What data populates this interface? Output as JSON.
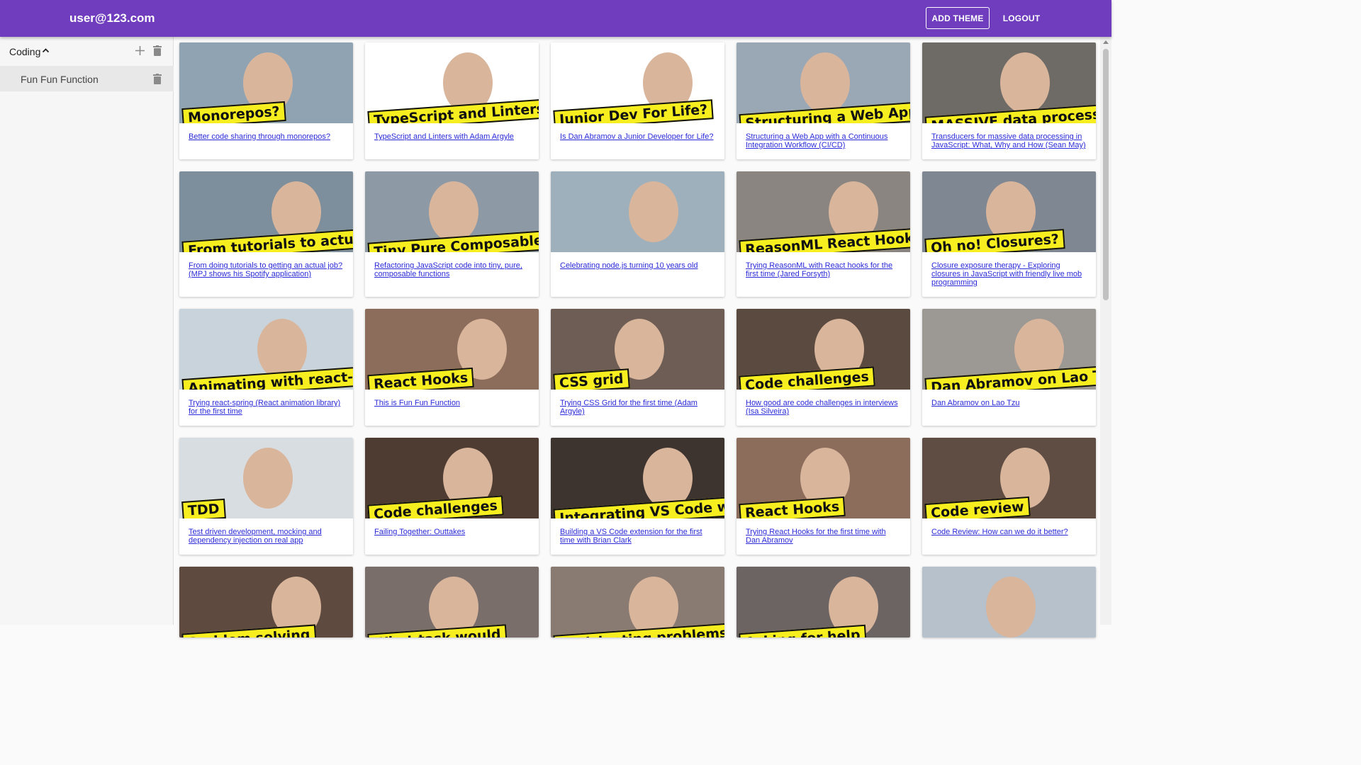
{
  "appbar": {
    "user": "user@123.com",
    "add_theme": "ADD THEME",
    "logout": "LOGOUT"
  },
  "sidebar": {
    "theme": {
      "name": "Coding"
    },
    "items": [
      {
        "label": "Fun Fun Function"
      }
    ]
  },
  "colors": {
    "appbar": "#6f3dbd",
    "link": "#2a2ad8",
    "tag_yellow": "#f6ee1f"
  },
  "videos": [
    {
      "title": "Better code sharing through monorepos?",
      "tag": "Monorepos?",
      "bg": "#8fa3b3"
    },
    {
      "title": "TypeScript and Linters with Adam Argyle",
      "tag": "TypeScript and Linters",
      "bg": "#ffffff"
    },
    {
      "title": "Is Dan Abramov a Junior Developer for Life?",
      "tag": "Junior Dev For Life?",
      "bg": "#ffffff"
    },
    {
      "title": "Structuring a Web App with a Continuous Integration Workflow (CI/CD)",
      "tag": "Structuring a Web App with CI/CD",
      "bg": "#9aa8b5"
    },
    {
      "title": "Transducers for massive data processing in JavaScript: What, Why and How (Sean May)",
      "tag": "MASSIVE data processing with Transducers",
      "bg": "#6e6a66"
    },
    {
      "title": "From doing tutorials to getting an actual job? (MPJ shows his Spotify application)",
      "tag": "From tutorials to actual job",
      "bg": "#7d8e9c"
    },
    {
      "title": "Refactoring JavaScript code into tiny, pure, composable functions",
      "tag": "Tiny Pure Composable Functions",
      "bg": "#8d9aa6"
    },
    {
      "title": "Celebrating node.js turning 10 years old",
      "tag": "",
      "bg": "#9fb0bd"
    },
    {
      "title": "Trying ReasonML with React hooks for the first time (Jared Forsyth)",
      "tag": "ReasonML React Hooks",
      "bg": "#8a8580"
    },
    {
      "title": "Closure exposure therapy - Exploring closures in JavaScript with friendly live mob programming",
      "tag": "Oh no! Closures?",
      "bg": "#7e8792"
    },
    {
      "title": "Trying react-spring (React animation library) for the first time",
      "tag": "Animating with react-spring",
      "bg": "#c9d3db"
    },
    {
      "title": "This is Fun Fun Function",
      "tag": "React Hooks",
      "bg": "#8c6d5c"
    },
    {
      "title": "Trying CSS Grid for the first time (Adam Argyle)",
      "tag": "CSS grid",
      "bg": "#6d5d54"
    },
    {
      "title": "How good are code challenges in interviews (Isa Silveira)",
      "tag": "Code challenges",
      "bg": "#5b4a40"
    },
    {
      "title": "Dan Abramov on Lao Tzu",
      "tag": "Dan Abramov on Lao Tzu",
      "bg": "#9c9894"
    },
    {
      "title": "Test driven development, mocking and dependency injection on real app",
      "tag": "TDD",
      "bg": "#d8dde2"
    },
    {
      "title": "Failing Together: Outtakes",
      "tag": "Code challenges",
      "bg": "#4e3c33"
    },
    {
      "title": "Building a VS Code extension for the first time with Brian Clark",
      "tag": "Integrating VS Code with Twitch",
      "bg": "#3d3430"
    },
    {
      "title": "Trying React Hooks for the first time with Dan Abramov",
      "tag": "React Hooks",
      "bg": "#8c6d5c"
    },
    {
      "title": "Code Review: How can we do it better?",
      "tag": "Code review",
      "bg": "#5f4d44"
    },
    {
      "title": "",
      "tag": "Problem solving",
      "bg": "#5e4a3f"
    },
    {
      "title": "",
      "tag": "What task would",
      "bg": "#7a6e6a"
    },
    {
      "title": "",
      "tag": "Anticipating problems",
      "bg": "#8a7b72"
    },
    {
      "title": "",
      "tag": "Asking for help",
      "bg": "#6c6462"
    },
    {
      "title": "",
      "tag": "",
      "bg": "#b6c1cb"
    }
  ]
}
